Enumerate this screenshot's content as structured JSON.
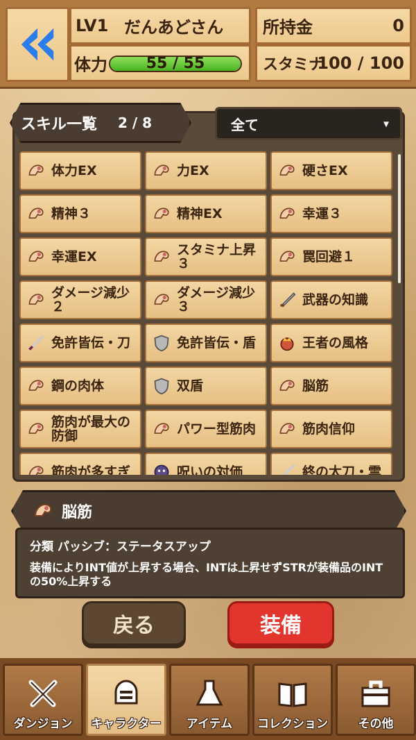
{
  "header": {
    "level": "LV1",
    "player_name": "だんあどさん",
    "hp_label": "体力",
    "hp_value": "55 / 55",
    "hp_fraction": 1.0,
    "gold_label": "所持金",
    "gold_value": "0",
    "stamina_label": "スタミナ",
    "stamina_value": "100 / 100"
  },
  "skill_list": {
    "title": "スキル一覧",
    "count": "2 / 8",
    "filter_label": "全て",
    "skills": [
      {
        "label": "体力EX",
        "icon": "muscle-arm-icon"
      },
      {
        "label": "力EX",
        "icon": "muscle-arm-icon"
      },
      {
        "label": "硬さEX",
        "icon": "muscle-arm-icon"
      },
      {
        "label": "精神３",
        "icon": "muscle-arm-icon"
      },
      {
        "label": "精神EX",
        "icon": "muscle-arm-icon"
      },
      {
        "label": "幸運３",
        "icon": "muscle-arm-icon"
      },
      {
        "label": "幸運EX",
        "icon": "muscle-arm-icon"
      },
      {
        "label": "スタミナ上昇３",
        "icon": "muscle-arm-icon"
      },
      {
        "label": "罠回避１",
        "icon": "muscle-arm-icon"
      },
      {
        "label": "ダメージ減少２",
        "icon": "muscle-arm-icon"
      },
      {
        "label": "ダメージ減少３",
        "icon": "muscle-arm-icon"
      },
      {
        "label": "武器の知識",
        "icon": "sword-icon"
      },
      {
        "label": "免許皆伝・刀",
        "icon": "katana-icon"
      },
      {
        "label": "免許皆伝・盾",
        "icon": "shield-icon"
      },
      {
        "label": "王者の風格",
        "icon": "crown-icon"
      },
      {
        "label": "鋼の肉体",
        "icon": "muscle-arm-icon"
      },
      {
        "label": "双盾",
        "icon": "shield-icon"
      },
      {
        "label": "脳筋",
        "icon": "muscle-arm-icon"
      },
      {
        "label": "筋肉が最大の防御",
        "icon": "muscle-arm-icon"
      },
      {
        "label": "パワー型筋肉",
        "icon": "muscle-arm-icon"
      },
      {
        "label": "筋肉信仰",
        "icon": "muscle-arm-icon"
      },
      {
        "label": "筋肉が多すぎ",
        "icon": "muscle-arm-icon"
      },
      {
        "label": "呪いの対価",
        "icon": "curse-icon"
      },
      {
        "label": "終の太刀・雲",
        "icon": "katana-icon"
      }
    ]
  },
  "detail": {
    "name": "脳筋",
    "category": "分類 パッシブ：ステータスアップ",
    "description": "装備によりINT値が上昇する場合、INTは上昇せずSTRが装備品のINTの50%上昇する"
  },
  "buttons": {
    "back": "戻る",
    "equip": "装備"
  },
  "nav": {
    "tabs": [
      {
        "label": "ダンジョン",
        "icon": "crossed-swords-icon",
        "active": false
      },
      {
        "label": "キャラクター",
        "icon": "helmet-icon",
        "active": true
      },
      {
        "label": "アイテム",
        "icon": "flask-icon",
        "active": false
      },
      {
        "label": "コレクション",
        "icon": "book-icon",
        "active": false
      },
      {
        "label": "その他",
        "icon": "toolbox-icon",
        "active": false
      }
    ]
  },
  "colors": {
    "accent_blue": "#2b7de9",
    "equip_red": "#e2352e",
    "hp_green": "#4ab321"
  }
}
